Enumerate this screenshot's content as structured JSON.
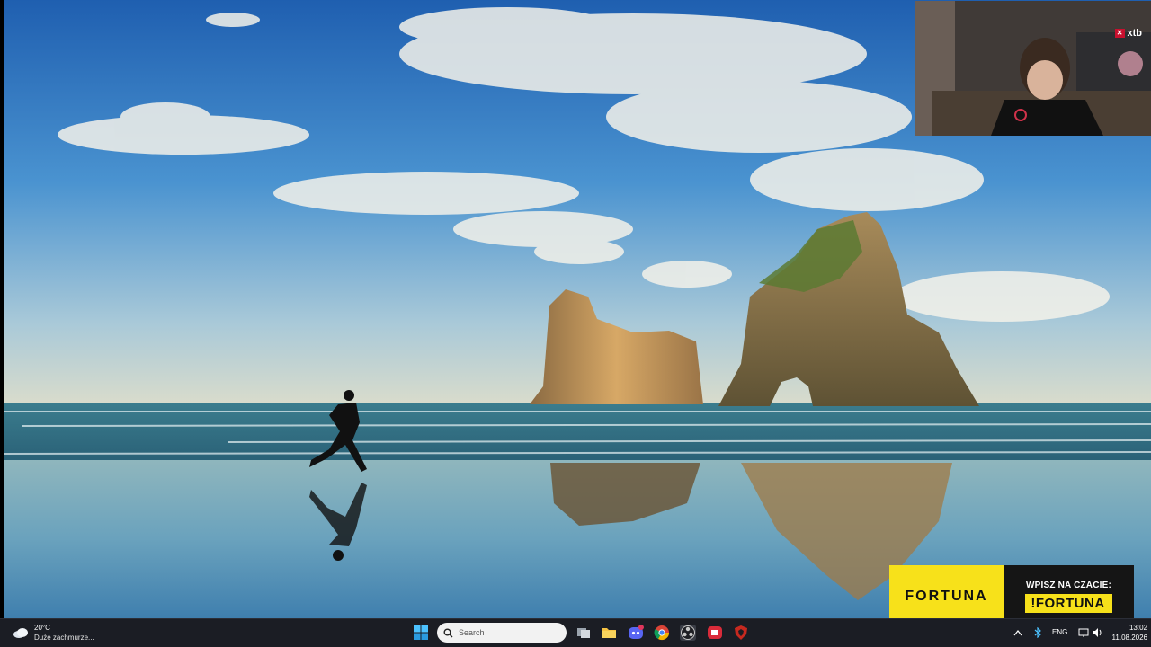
{
  "webcam": {
    "brand": "xtb"
  },
  "ad": {
    "brand": "FORTUNA",
    "call_to_action": "WPISZ NA CZACIE:",
    "command": "!FORTUNA"
  },
  "taskbar": {
    "weather": {
      "temperature": "20°C",
      "description": "Duże zachmurze..."
    },
    "search_placeholder": "Search",
    "apps": [
      {
        "name": "windows-start"
      },
      {
        "name": "task-view"
      },
      {
        "name": "file-explorer"
      },
      {
        "name": "discord",
        "badge": "7"
      },
      {
        "name": "chrome"
      },
      {
        "name": "obs"
      },
      {
        "name": "app-red"
      },
      {
        "name": "app-shield"
      }
    ],
    "tray": {
      "language": "ENG"
    },
    "clock": {
      "time": "13:02",
      "date": "11.08.2026"
    }
  },
  "colors": {
    "sky_top": "#1f5fb0",
    "sea": "#2d6f86",
    "fortuna_yellow": "#f7e11a",
    "taskbar": "#1b1d24"
  }
}
